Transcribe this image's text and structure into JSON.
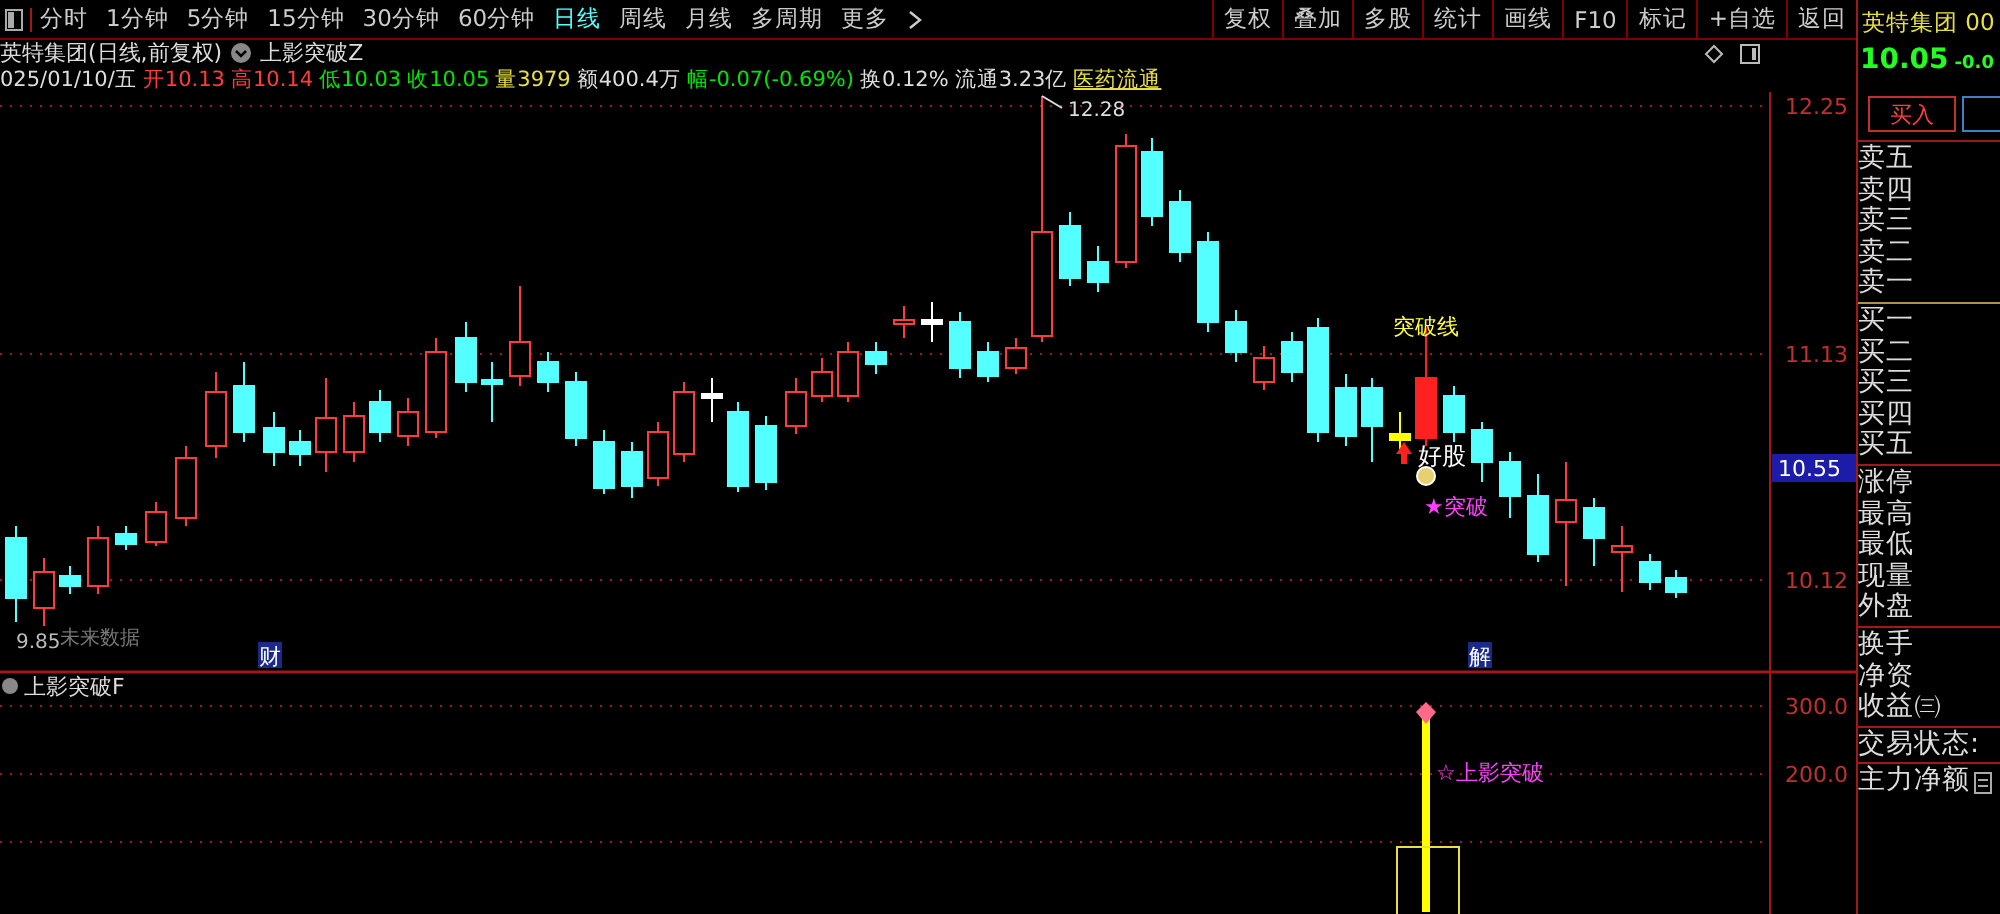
{
  "toolbar": {
    "periods": [
      {
        "label": "分时",
        "selected": false
      },
      {
        "label": "1分钟",
        "selected": false
      },
      {
        "label": "5分钟",
        "selected": false
      },
      {
        "label": "15分钟",
        "selected": false
      },
      {
        "label": "30分钟",
        "selected": false
      },
      {
        "label": "60分钟",
        "selected": false
      },
      {
        "label": "日线",
        "selected": true
      },
      {
        "label": "周线",
        "selected": false
      },
      {
        "label": "月线",
        "selected": false
      },
      {
        "label": "多周期",
        "selected": false
      },
      {
        "label": "更多",
        "selected": false
      }
    ],
    "actions": [
      "复权",
      "叠加",
      "多股",
      "统计",
      "画线",
      "F10",
      "标记",
      "+自选",
      "返回"
    ]
  },
  "title_row": {
    "security": "英特集团(日线,前复权)",
    "indicator": "上影突破Z"
  },
  "quote_row": [
    {
      "text": "025/01/10/五",
      "kind": "plain"
    },
    {
      "text": "开10.13",
      "kind": "up"
    },
    {
      "text": "高10.14",
      "kind": "up"
    },
    {
      "text": "低10.03",
      "kind": "down"
    },
    {
      "text": "收10.05",
      "kind": "down"
    },
    {
      "text": "量3979",
      "kind": "volume"
    },
    {
      "text": "额400.4万",
      "kind": "plain"
    },
    {
      "text": "幅-0.07(-0.69%)",
      "kind": "down"
    },
    {
      "text": "换0.12%",
      "kind": "plain"
    },
    {
      "text": "流通3.23亿",
      "kind": "plain"
    },
    {
      "text": "医药流通",
      "kind": "link"
    }
  ],
  "chart": {
    "price_axis": [
      "12.25",
      "11.13",
      "10.12"
    ],
    "cursor_price": "10.55",
    "peak_label": "12.28",
    "low_label": "9.85",
    "hint": "未来数据",
    "markers": [
      "财",
      "解"
    ],
    "breakout_line": "突破线",
    "good_stock": "好股",
    "breakout": "★突破"
  },
  "indicator_panel": {
    "title": "上影突破F",
    "axis": [
      "300.0",
      "200.0"
    ],
    "signal": "☆上影突破"
  },
  "quote_panel": {
    "name": "英特集团 00",
    "price": "10.05",
    "change": "-0.0",
    "buttons": [
      {
        "label": "买入",
        "kind": "buy"
      },
      {
        "kind": "sell"
      }
    ],
    "asks": [
      "卖五",
      "卖四",
      "卖三",
      "卖二",
      "卖一"
    ],
    "bids": [
      "买一",
      "买二",
      "买三",
      "买四",
      "买五"
    ],
    "stats": [
      "涨停",
      "最高",
      "最低",
      "现量",
      "外盘"
    ],
    "fundamentals": [
      "换手",
      "净资",
      "收益㈢"
    ],
    "status": "交易状态:",
    "main_net": "主力净额"
  }
}
